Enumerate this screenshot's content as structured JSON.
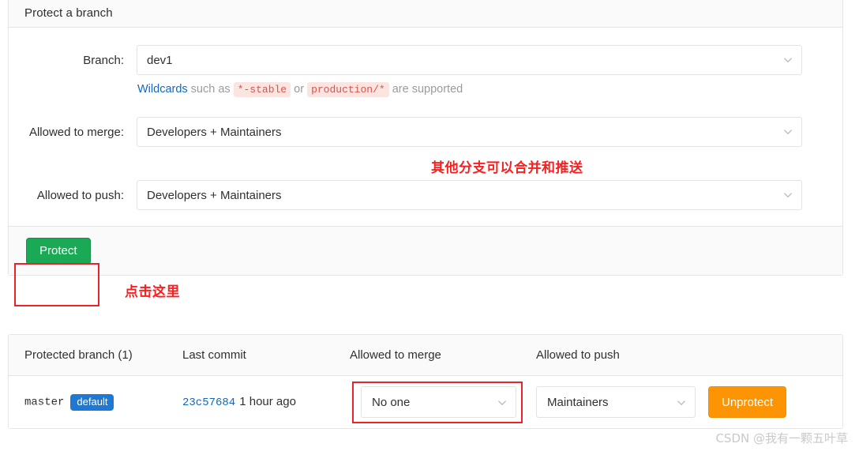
{
  "panel": {
    "title": "Protect a branch",
    "fields": [
      {
        "label": "Branch:",
        "value": "dev1"
      },
      {
        "label": "Allowed to merge:",
        "value": "Developers + Maintainers"
      },
      {
        "label": "Allowed to push:",
        "value": "Developers + Maintainers"
      }
    ],
    "help": {
      "link_text": "Wildcards",
      "mid_1": " such as ",
      "code_1": "*-stable",
      "mid_2": " or ",
      "code_2": "production/*",
      "tail": " are supported"
    },
    "protect_button": "Protect"
  },
  "annotations": {
    "merge_push_note": "其他分支可以合并和推送",
    "click_here": "点击这里"
  },
  "table": {
    "headers": [
      "Protected branch (1)",
      "Last commit",
      "Allowed to merge",
      "Allowed to push"
    ],
    "rows": [
      {
        "branch": "master",
        "badge": "default",
        "commit_sha": "23c57684",
        "commit_time": "1 hour ago",
        "allowed_merge": "No one",
        "allowed_push": "Maintainers",
        "action": "Unprotect"
      }
    ]
  },
  "watermark": "CSDN @我有一颗五叶草",
  "colors": {
    "protect_green": "#1aaa55",
    "unprotect_orange": "#fc9403",
    "badge_blue": "#1f78d1",
    "link_blue": "#1068bf",
    "annotation_red": "#fa1f1f",
    "highlight_red": "#e8232a",
    "code_red": "#d9534f"
  }
}
